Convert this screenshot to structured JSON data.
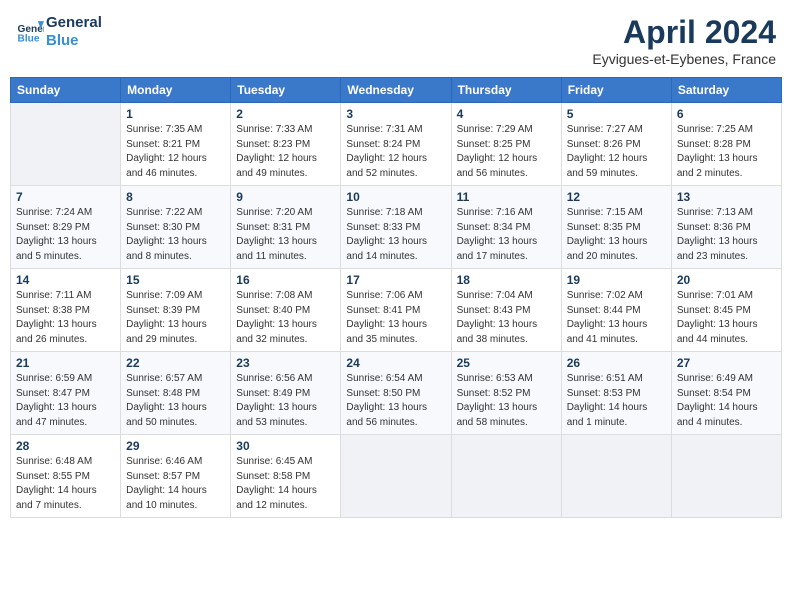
{
  "header": {
    "logo_line1": "General",
    "logo_line2": "Blue",
    "month_title": "April 2024",
    "location": "Eyvigues-et-Eybenes, France"
  },
  "days_of_week": [
    "Sunday",
    "Monday",
    "Tuesday",
    "Wednesday",
    "Thursday",
    "Friday",
    "Saturday"
  ],
  "weeks": [
    {
      "days": [
        {
          "num": "",
          "info": ""
        },
        {
          "num": "1",
          "info": "Sunrise: 7:35 AM\nSunset: 8:21 PM\nDaylight: 12 hours\nand 46 minutes."
        },
        {
          "num": "2",
          "info": "Sunrise: 7:33 AM\nSunset: 8:23 PM\nDaylight: 12 hours\nand 49 minutes."
        },
        {
          "num": "3",
          "info": "Sunrise: 7:31 AM\nSunset: 8:24 PM\nDaylight: 12 hours\nand 52 minutes."
        },
        {
          "num": "4",
          "info": "Sunrise: 7:29 AM\nSunset: 8:25 PM\nDaylight: 12 hours\nand 56 minutes."
        },
        {
          "num": "5",
          "info": "Sunrise: 7:27 AM\nSunset: 8:26 PM\nDaylight: 12 hours\nand 59 minutes."
        },
        {
          "num": "6",
          "info": "Sunrise: 7:25 AM\nSunset: 8:28 PM\nDaylight: 13 hours\nand 2 minutes."
        }
      ]
    },
    {
      "days": [
        {
          "num": "7",
          "info": "Sunrise: 7:24 AM\nSunset: 8:29 PM\nDaylight: 13 hours\nand 5 minutes."
        },
        {
          "num": "8",
          "info": "Sunrise: 7:22 AM\nSunset: 8:30 PM\nDaylight: 13 hours\nand 8 minutes."
        },
        {
          "num": "9",
          "info": "Sunrise: 7:20 AM\nSunset: 8:31 PM\nDaylight: 13 hours\nand 11 minutes."
        },
        {
          "num": "10",
          "info": "Sunrise: 7:18 AM\nSunset: 8:33 PM\nDaylight: 13 hours\nand 14 minutes."
        },
        {
          "num": "11",
          "info": "Sunrise: 7:16 AM\nSunset: 8:34 PM\nDaylight: 13 hours\nand 17 minutes."
        },
        {
          "num": "12",
          "info": "Sunrise: 7:15 AM\nSunset: 8:35 PM\nDaylight: 13 hours\nand 20 minutes."
        },
        {
          "num": "13",
          "info": "Sunrise: 7:13 AM\nSunset: 8:36 PM\nDaylight: 13 hours\nand 23 minutes."
        }
      ]
    },
    {
      "days": [
        {
          "num": "14",
          "info": "Sunrise: 7:11 AM\nSunset: 8:38 PM\nDaylight: 13 hours\nand 26 minutes."
        },
        {
          "num": "15",
          "info": "Sunrise: 7:09 AM\nSunset: 8:39 PM\nDaylight: 13 hours\nand 29 minutes."
        },
        {
          "num": "16",
          "info": "Sunrise: 7:08 AM\nSunset: 8:40 PM\nDaylight: 13 hours\nand 32 minutes."
        },
        {
          "num": "17",
          "info": "Sunrise: 7:06 AM\nSunset: 8:41 PM\nDaylight: 13 hours\nand 35 minutes."
        },
        {
          "num": "18",
          "info": "Sunrise: 7:04 AM\nSunset: 8:43 PM\nDaylight: 13 hours\nand 38 minutes."
        },
        {
          "num": "19",
          "info": "Sunrise: 7:02 AM\nSunset: 8:44 PM\nDaylight: 13 hours\nand 41 minutes."
        },
        {
          "num": "20",
          "info": "Sunrise: 7:01 AM\nSunset: 8:45 PM\nDaylight: 13 hours\nand 44 minutes."
        }
      ]
    },
    {
      "days": [
        {
          "num": "21",
          "info": "Sunrise: 6:59 AM\nSunset: 8:47 PM\nDaylight: 13 hours\nand 47 minutes."
        },
        {
          "num": "22",
          "info": "Sunrise: 6:57 AM\nSunset: 8:48 PM\nDaylight: 13 hours\nand 50 minutes."
        },
        {
          "num": "23",
          "info": "Sunrise: 6:56 AM\nSunset: 8:49 PM\nDaylight: 13 hours\nand 53 minutes."
        },
        {
          "num": "24",
          "info": "Sunrise: 6:54 AM\nSunset: 8:50 PM\nDaylight: 13 hours\nand 56 minutes."
        },
        {
          "num": "25",
          "info": "Sunrise: 6:53 AM\nSunset: 8:52 PM\nDaylight: 13 hours\nand 58 minutes."
        },
        {
          "num": "26",
          "info": "Sunrise: 6:51 AM\nSunset: 8:53 PM\nDaylight: 14 hours\nand 1 minute."
        },
        {
          "num": "27",
          "info": "Sunrise: 6:49 AM\nSunset: 8:54 PM\nDaylight: 14 hours\nand 4 minutes."
        }
      ]
    },
    {
      "days": [
        {
          "num": "28",
          "info": "Sunrise: 6:48 AM\nSunset: 8:55 PM\nDaylight: 14 hours\nand 7 minutes."
        },
        {
          "num": "29",
          "info": "Sunrise: 6:46 AM\nSunset: 8:57 PM\nDaylight: 14 hours\nand 10 minutes."
        },
        {
          "num": "30",
          "info": "Sunrise: 6:45 AM\nSunset: 8:58 PM\nDaylight: 14 hours\nand 12 minutes."
        },
        {
          "num": "",
          "info": ""
        },
        {
          "num": "",
          "info": ""
        },
        {
          "num": "",
          "info": ""
        },
        {
          "num": "",
          "info": ""
        }
      ]
    }
  ]
}
